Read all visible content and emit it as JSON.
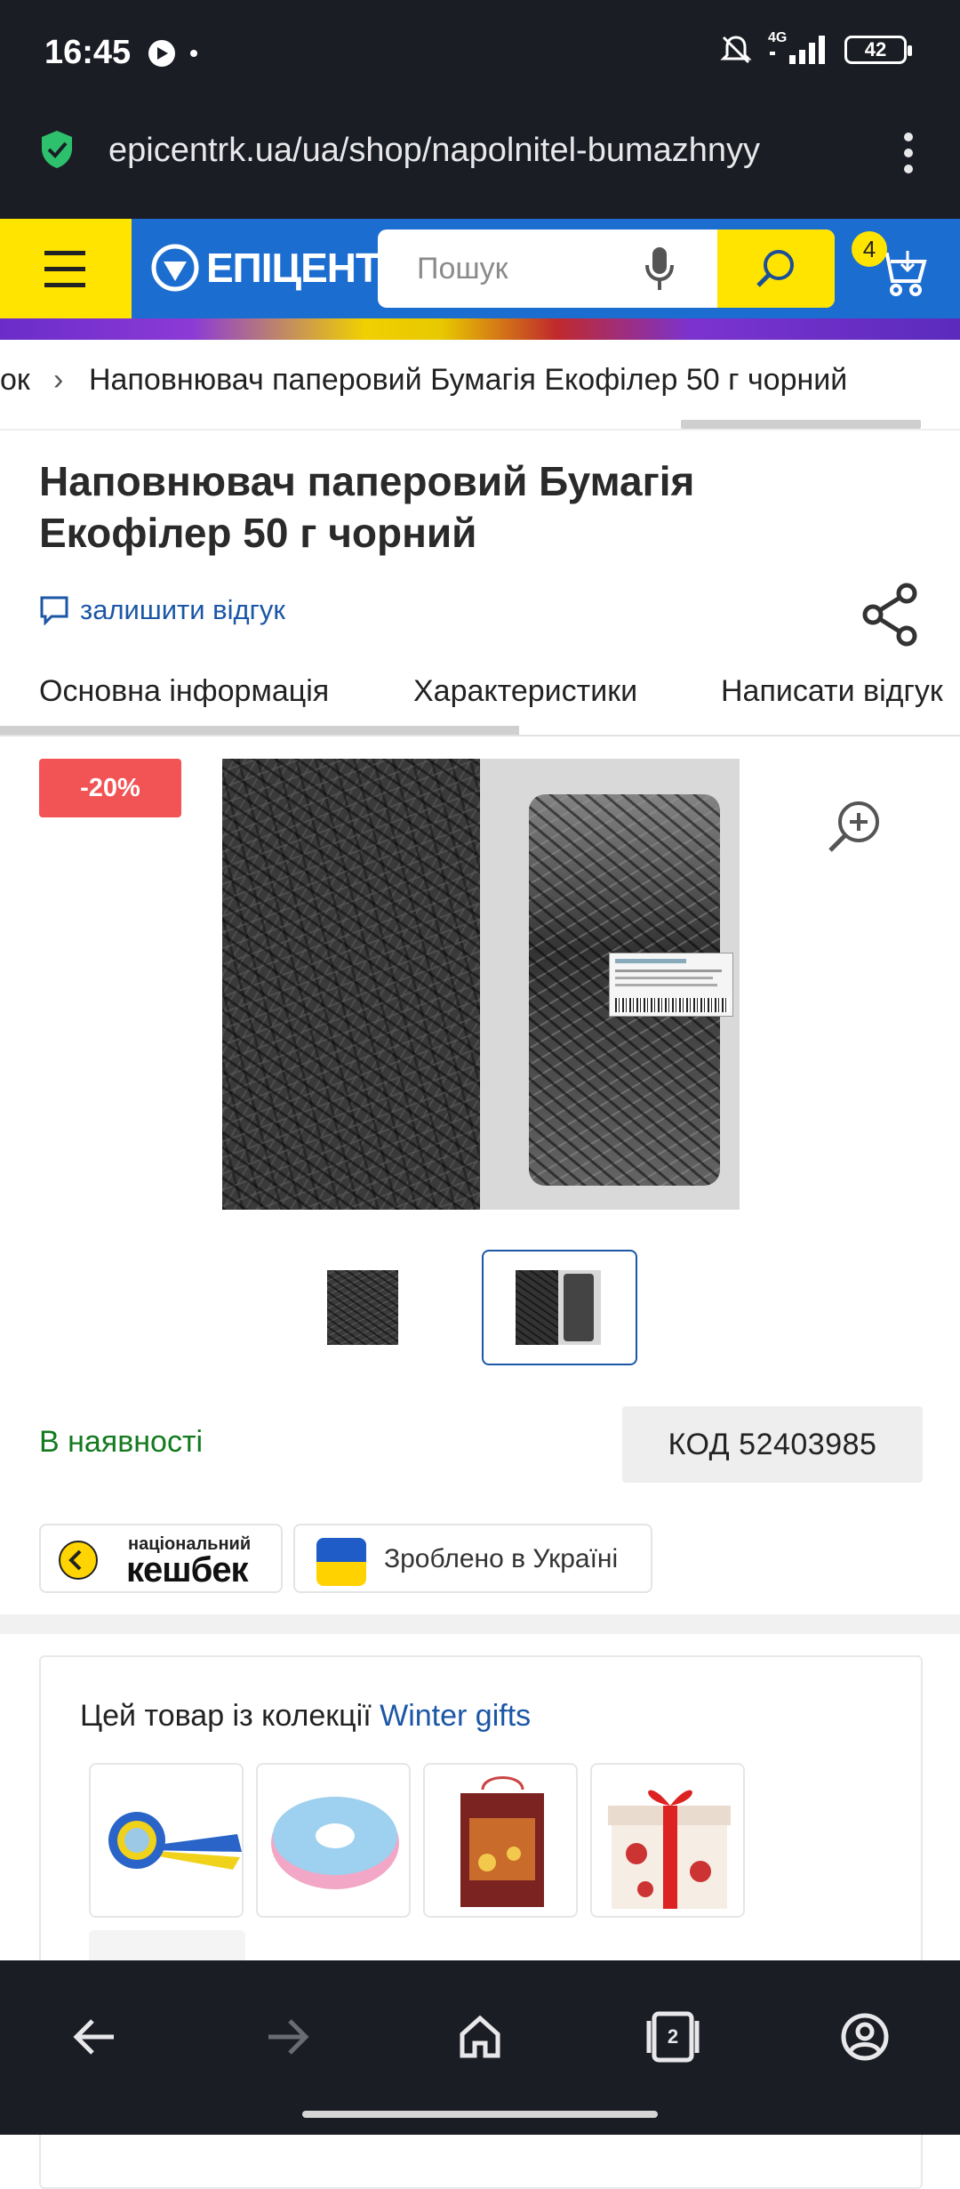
{
  "status_bar": {
    "time": "16:45",
    "network": "4G",
    "battery": "42",
    "icons": [
      "media-icon",
      "dot-icon",
      "mute-icon",
      "signal-icon",
      "battery-icon"
    ]
  },
  "browser": {
    "url": "epicentrk.ua/ua/shop/napolnitel-bumazhnyy",
    "secure_icon": "shield-check-icon",
    "menu_icon": "more-vert-icon"
  },
  "header": {
    "logo_text": "ЕПІЦЕНТР",
    "search_placeholder": "Пошук",
    "cart_count": "4",
    "colors": {
      "brand_blue": "#1c6dd0",
      "brand_yellow": "#ffe400"
    }
  },
  "breadcrumb": {
    "prev": "ок",
    "current": "Наповнювач паперовий Бумагія Екофілер 50 г чорний"
  },
  "product": {
    "title": "Наповнювач паперовий Бумагія Екофілер 50 г чорний",
    "review_link": "залишити відгук",
    "discount": "-20%",
    "availability": "В наявності",
    "code": "КОД 52403985",
    "selected_thumbnail": 2
  },
  "tabs": [
    {
      "label": "Основна інформація",
      "active": true
    },
    {
      "label": "Характеристики",
      "active": false
    },
    {
      "label": "Написати відгук",
      "active": false
    }
  ],
  "badges": {
    "cashback_small": "національний",
    "cashback_big": "кешбек",
    "made_in": "Зроблено в Україні"
  },
  "collection": {
    "prefix": "Цей товар із колекції ",
    "link": "Winter gifts"
  },
  "bottom_nav": [
    "back-icon",
    "forward-icon",
    "home-icon",
    "tabs-icon",
    "account-icon"
  ],
  "bottom_nav_tabs_count": "2"
}
